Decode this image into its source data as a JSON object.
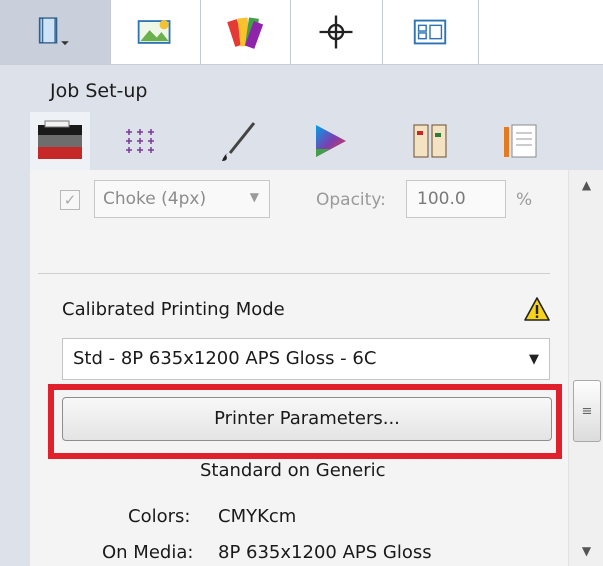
{
  "toolbar": {
    "tabs": [
      "job-icon",
      "image-icon",
      "color-swatch-icon",
      "crosshair-icon",
      "layout-icon"
    ]
  },
  "job_setup": {
    "title": "Job Set-up",
    "icon_tabs": [
      "printer-icon",
      "grid-marks-icon",
      "brush-icon",
      "color-triangle-icon",
      "book-icon",
      "notes-icon"
    ]
  },
  "choke": {
    "checked": true,
    "value": "Choke (4px)",
    "opacity_label": "Opacity:",
    "opacity_value": "100.0",
    "opacity_unit": "%"
  },
  "calibrated": {
    "title": "Calibrated Printing Mode",
    "mode": "Std - 8P 635x1200 APS Gloss - 6C",
    "params_button": "Printer Parameters...",
    "standard_line": "Standard on Generic",
    "colors_label": "Colors:",
    "colors_value": "CMYKcm",
    "media_label": "On Media:",
    "media_value": "8P 635x1200 APS Gloss"
  },
  "colors": {
    "highlight": "#e0202b",
    "warning": "#f7d21a"
  }
}
